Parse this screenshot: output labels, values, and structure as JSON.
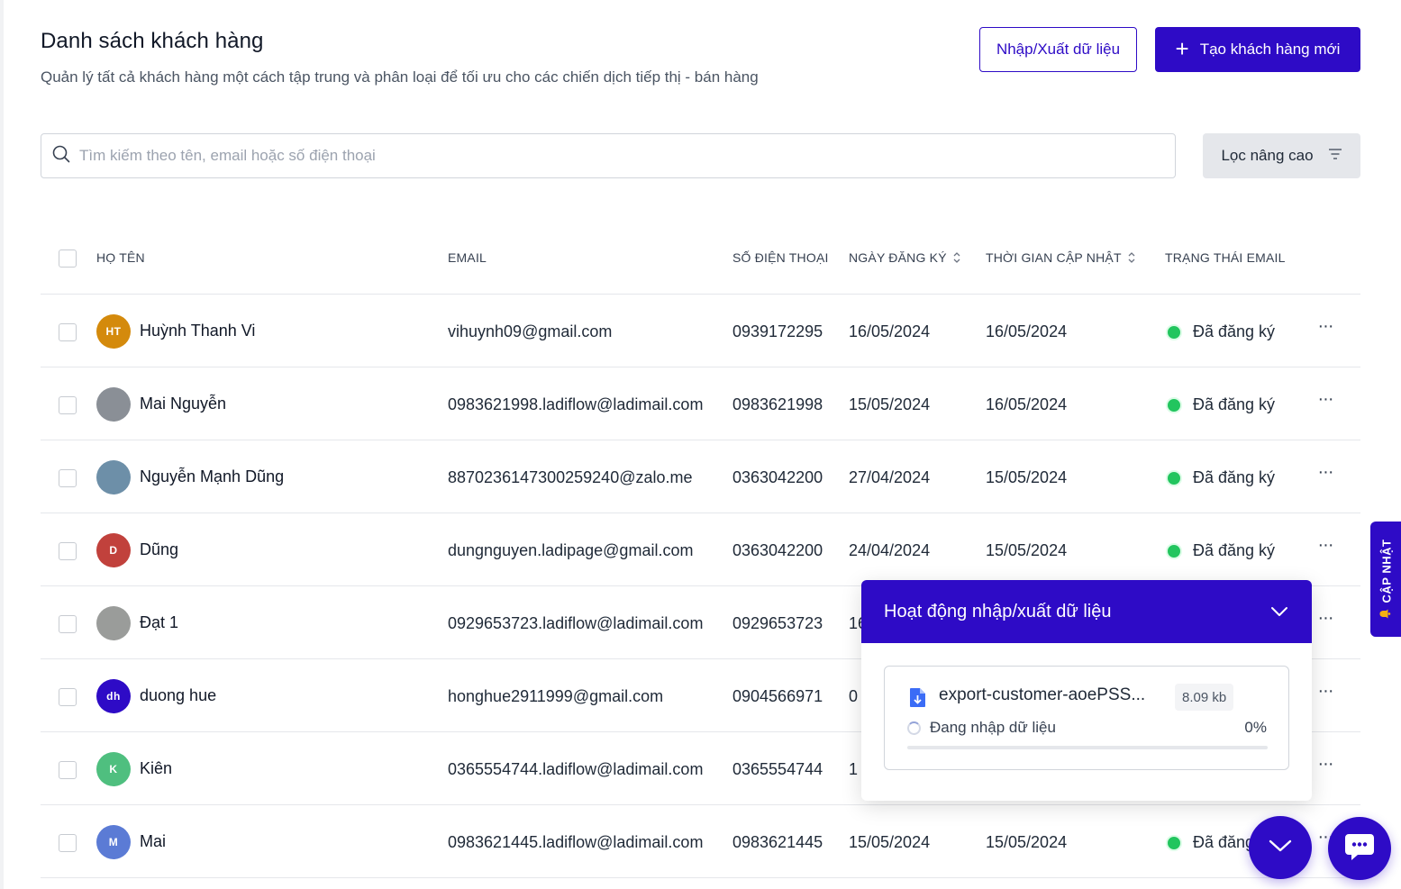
{
  "header": {
    "title": "Danh sách khách hàng",
    "subtitle": "Quản lý tất cả khách hàng một cách tập trung và phân loại để tối ưu cho các chiến dịch tiếp thị - bán hàng",
    "import_export_label": "Nhập/Xuất dữ liệu",
    "create_label": "Tạo khách hàng mới"
  },
  "search": {
    "placeholder": "Tìm kiếm theo tên, email hoặc số điện thoại",
    "value": ""
  },
  "filter": {
    "label": "Lọc nâng cao"
  },
  "table": {
    "columns": {
      "name": "HỌ TÊN",
      "email": "EMAIL",
      "phone": "SỐ ĐIỆN THOẠI",
      "registered": "NGÀY ĐĂNG KÝ",
      "updated": "THỜI GIAN CẬP NHẬT",
      "email_status": "TRẠNG THÁI EMAIL"
    },
    "rows": [
      {
        "initials": "HT",
        "avatar_color": "#d48a0c",
        "name": "Huỳnh Thanh Vi",
        "email": "vihuynh09@gmail.com",
        "phone": "0939172295",
        "registered": "16/05/2024",
        "updated": "16/05/2024",
        "status": "Đã đăng ký"
      },
      {
        "initials": "",
        "avatar_color": "#8a8f96",
        "name": "Mai Nguyễn",
        "email": "0983621998.ladiflow@ladimail.com",
        "phone": "0983621998",
        "registered": "15/05/2024",
        "updated": "16/05/2024",
        "status": "Đã đăng ký"
      },
      {
        "initials": "",
        "avatar_color": "#6d8fa8",
        "name": "Nguyễn Mạnh Dũng",
        "email": "8870236147300259240@zalo.me",
        "phone": "0363042200",
        "registered": "27/04/2024",
        "updated": "15/05/2024",
        "status": "Đã đăng ký"
      },
      {
        "initials": "D",
        "avatar_color": "#c1413c",
        "name": "Dũng",
        "email": "dungnguyen.ladipage@gmail.com",
        "phone": "0363042200",
        "registered": "24/04/2024",
        "updated": "15/05/2024",
        "status": "Đã đăng ký"
      },
      {
        "initials": "",
        "avatar_color": "#9a9c9a",
        "name": "Đạt 1",
        "email": "0929653723.ladiflow@ladimail.com",
        "phone": "0929653723",
        "registered": "16",
        "updated": "",
        "status": ""
      },
      {
        "initials": "dh",
        "avatar_color": "#2e0bc6",
        "name": "duong hue",
        "email": "honghue2911999@gmail.com",
        "phone": "0904566971",
        "registered": "0",
        "updated": "",
        "status": ""
      },
      {
        "initials": "K",
        "avatar_color": "#4fbf7f",
        "name": "Kiên",
        "email": "0365554744.ladiflow@ladimail.com",
        "phone": "0365554744",
        "registered": "1",
        "updated": "",
        "status": ""
      },
      {
        "initials": "M",
        "avatar_color": "#5b7bd5",
        "name": "Mai",
        "email": "0983621445.ladiflow@ladimail.com",
        "phone": "0983621445",
        "registered": "15/05/2024",
        "updated": "15/05/2024",
        "status": "Đã đăng"
      }
    ]
  },
  "activity_panel": {
    "title": "Hoạt động nhập/xuất dữ liệu",
    "file_name": "export-customer-aoePSS...",
    "file_size": "8.09 kb",
    "status": "Đang nhập dữ liệu",
    "percent_label": "0%",
    "progress_fraction": 0
  },
  "side_tab": {
    "label": "CẬP NHẬT"
  },
  "colors": {
    "primary": "#2e0bc6",
    "status_green": "#22c55e"
  }
}
